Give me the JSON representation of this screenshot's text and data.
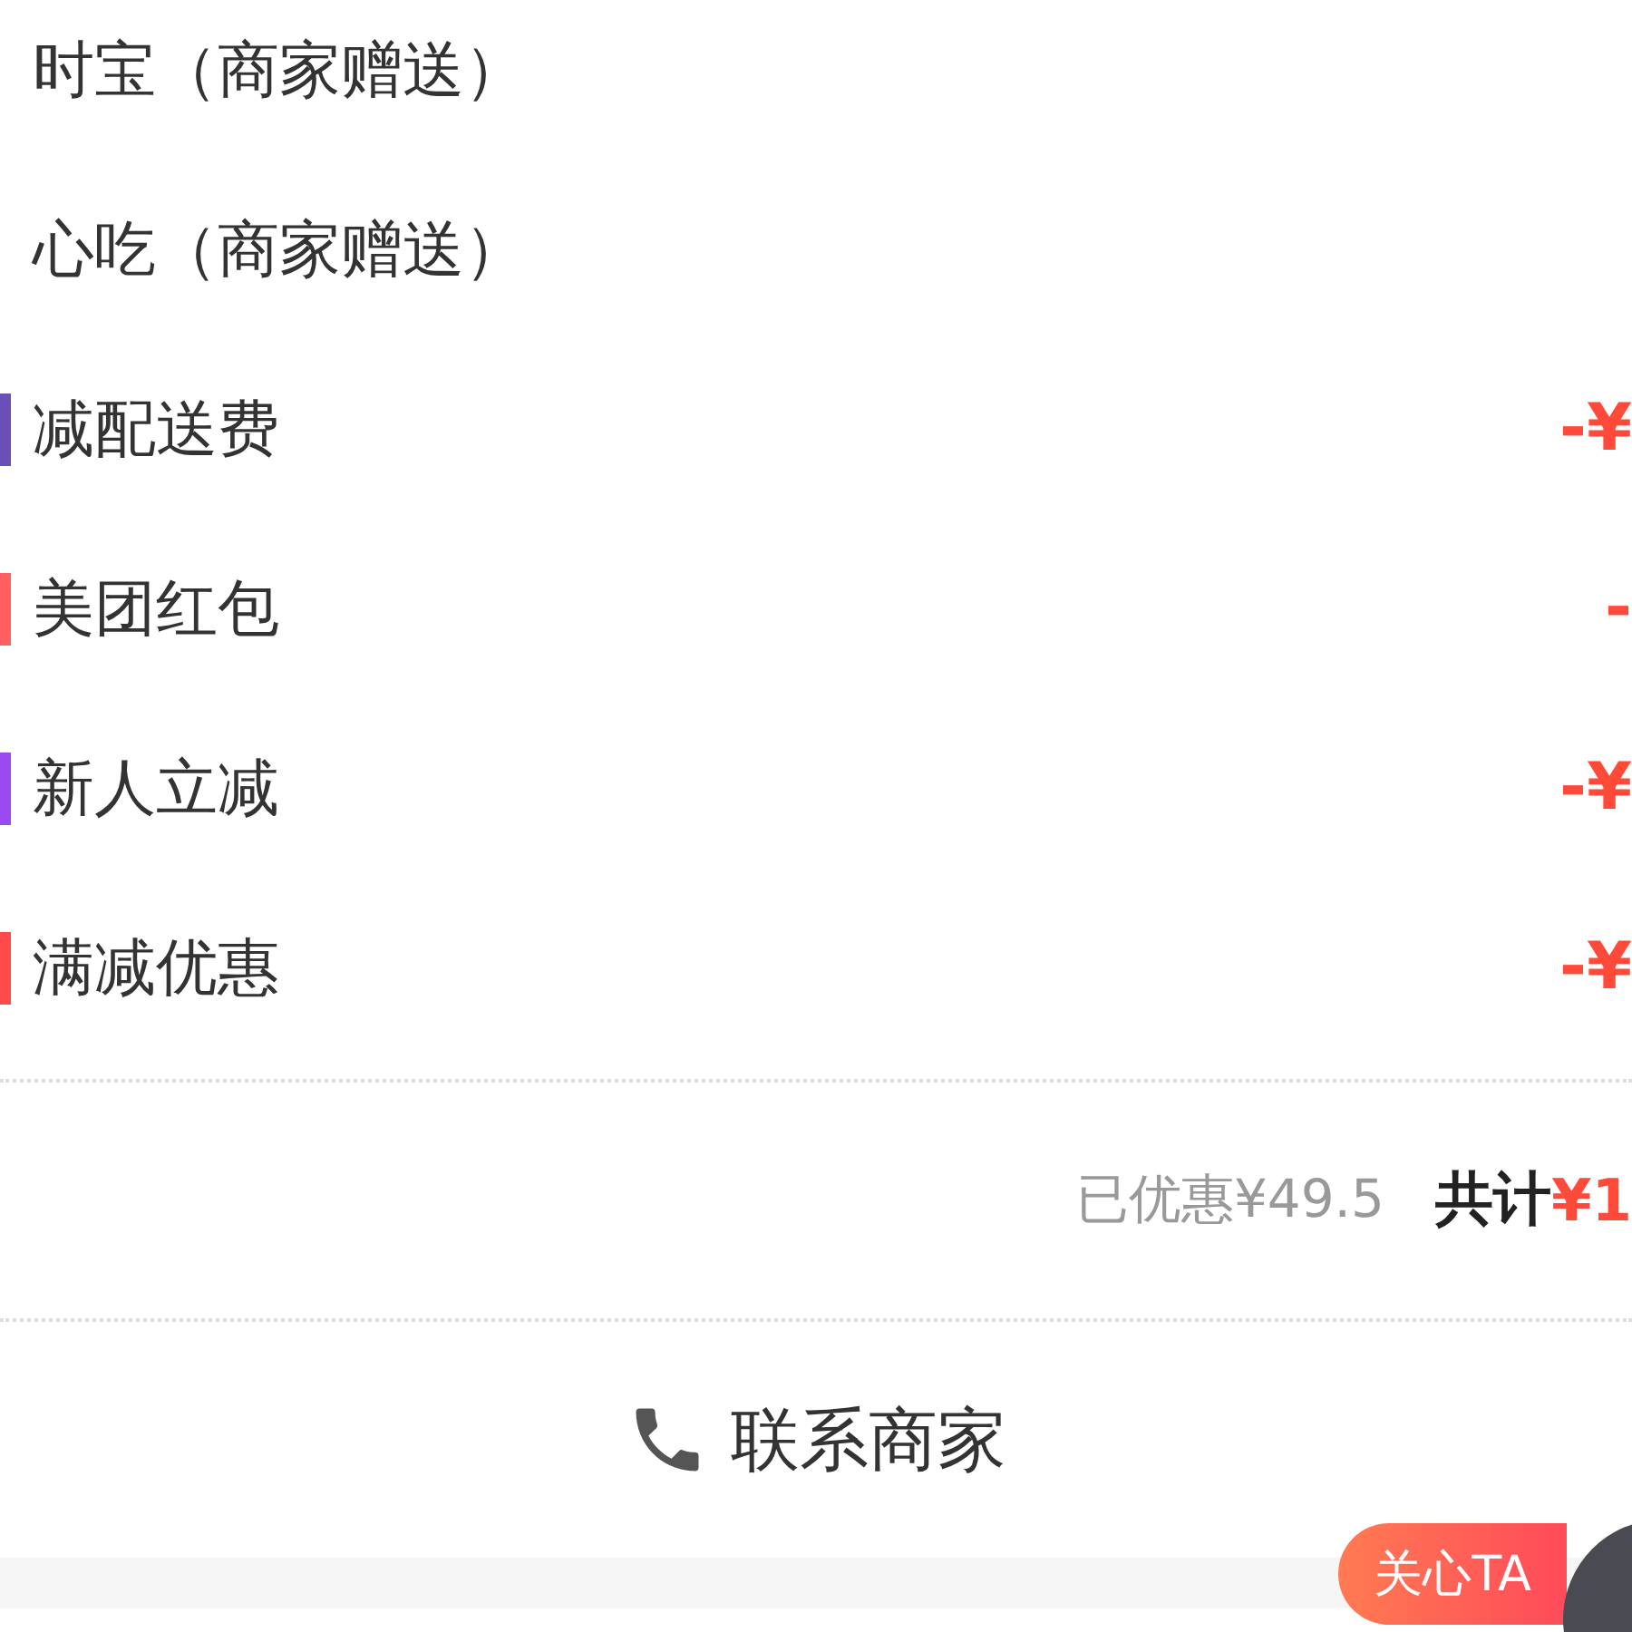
{
  "items": [
    {
      "kind": "gift",
      "label": "时宝（商家赠送）"
    },
    {
      "kind": "gift",
      "label": "心吃（商家赠送）"
    },
    {
      "kind": "discount",
      "label": "减配送费",
      "color": "#6a4fb8",
      "amount": "-¥"
    },
    {
      "kind": "discount",
      "label": "美团红包",
      "color": "#ff5f5f",
      "amount": "-"
    },
    {
      "kind": "discount",
      "label": "新人立减",
      "color": "#9b4af2",
      "amount": "-¥"
    },
    {
      "kind": "discount",
      "label": "满减优惠",
      "color": "#ff4a4a",
      "amount": "-¥"
    }
  ],
  "summary": {
    "saved": "已优惠¥49.5",
    "total_label": "共计",
    "total": "¥1"
  },
  "contact": {
    "label": "联系商家"
  },
  "care_badge": {
    "label": "关心TA"
  }
}
